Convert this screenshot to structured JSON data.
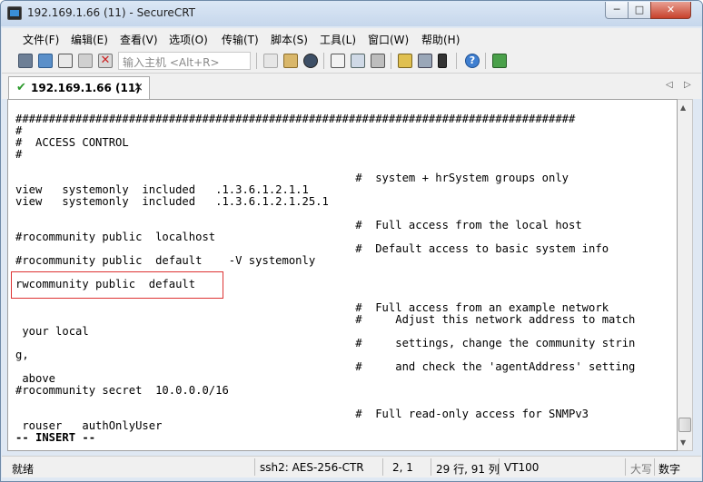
{
  "window": {
    "title": "192.169.1.66 (11) - SecureCRT",
    "controls": {
      "minimize": "─",
      "maximize": "□",
      "close": "✕"
    }
  },
  "menu": [
    "文件(F)",
    "编辑(E)",
    "查看(V)",
    "选项(O)",
    "传输(T)",
    "脚本(S)",
    "工具(L)",
    "窗口(W)",
    "帮助(H)"
  ],
  "toolbar": {
    "host_input_placeholder": "输入主机 <Alt+R>",
    "icons": [
      "connect-icon",
      "quick-connect-icon",
      "connect-tab-icon",
      "reconnect-icon",
      "disconnect-icon",
      "copy-icon",
      "paste-icon",
      "find-icon",
      "print-icon",
      "print-screen-icon",
      "printer-icon",
      "session-options-icon",
      "global-options-icon",
      "keymap-icon",
      "help-icon",
      "sftp-icon"
    ]
  },
  "tabs": [
    {
      "label": "192.169.1.66 (11)",
      "close": "×"
    }
  ],
  "tab_nav": {
    "prev": "◁",
    "next": "▷"
  },
  "terminal": {
    "lines": [
      "####################################################################################",
      "#",
      "#  ACCESS CONTROL",
      "#",
      "                                                   #  system + hrSystem groups only",
      "view   systemonly  included   .1.3.6.1.2.1.1",
      "view   systemonly  included   .1.3.6.1.2.1.25.1",
      "",
      "                                                   #  Full access from the local host",
      "#rocommunity public  localhost",
      "                                                   #  Default access to basic system info",
      "#rocommunity public  default    -V systemonly",
      "",
      "rwcommunity public  default",
      "",
      "                                                   #  Full access from an example network",
      "                                                   #     Adjust this network address to match",
      " your local",
      "                                                   #     settings, change the community strin",
      "g,",
      "                                                   #     and check the 'agentAddress' setting",
      " above",
      "#rocommunity secret  10.0.0.0/16",
      "",
      "                                                   #  Full read-only access for SNMPv3",
      " rouser   authOnlyUser",
      "-- INSERT --"
    ]
  },
  "status": {
    "ready": "就绪",
    "cipher": "ssh2: AES-256-CTR",
    "cursor_pos": "2,   1",
    "rows_cols": "29 行, 91 列",
    "emulation": "VT100",
    "caps": "大写",
    "num": "数字"
  },
  "colors": {
    "highlight_box": "#dd3333",
    "tab_check": "#2c9a2c",
    "close_button": "#c7412b"
  }
}
